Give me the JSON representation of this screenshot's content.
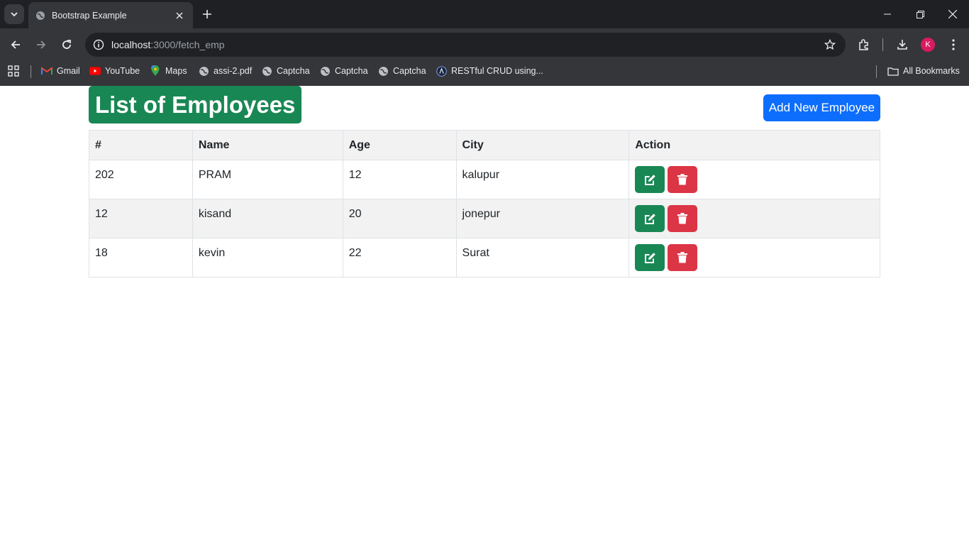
{
  "browser": {
    "tab_title": "Bootstrap Example",
    "url_host": "localhost",
    "url_path": ":3000/fetch_emp",
    "profile_initial": "K",
    "bookmarks": [
      {
        "label": "Gmail",
        "icon": "gmail-icon"
      },
      {
        "label": "YouTube",
        "icon": "youtube-icon"
      },
      {
        "label": "Maps",
        "icon": "maps-icon"
      },
      {
        "label": "assi-2.pdf",
        "icon": "globe-icon"
      },
      {
        "label": "Captcha",
        "icon": "globe-icon"
      },
      {
        "label": "Captcha",
        "icon": "globe-icon"
      },
      {
        "label": "Captcha",
        "icon": "globe-icon"
      },
      {
        "label": "RESTful CRUD using...",
        "icon": "site-icon"
      }
    ],
    "all_bookmarks": "All Bookmarks"
  },
  "page": {
    "title": "List of Employees",
    "add_button": "Add New Employee",
    "columns": [
      "#",
      "Name",
      "Age",
      "City",
      "Action"
    ],
    "rows": [
      {
        "id": "202",
        "name": "PRAM",
        "age": "12",
        "city": "kalupur"
      },
      {
        "id": "12",
        "name": "kisand",
        "age": "20",
        "city": "jonepur"
      },
      {
        "id": "18",
        "name": "kevin",
        "age": "22",
        "city": "Surat"
      }
    ]
  },
  "colors": {
    "title_bg": "#198754",
    "primary": "#0d6efd",
    "edit": "#198754",
    "delete": "#dc3545"
  }
}
